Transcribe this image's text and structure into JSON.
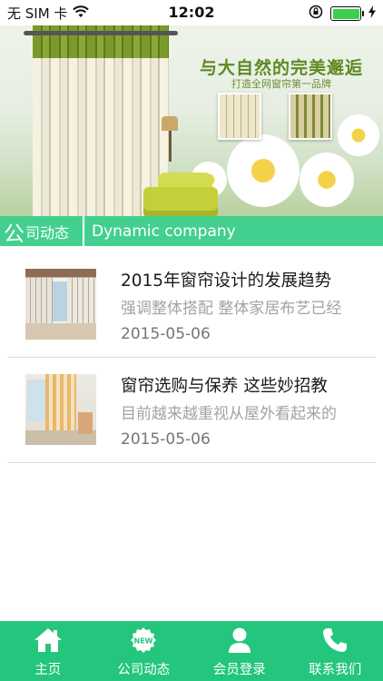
{
  "status_bar": {
    "carrier": "无 SIM 卡",
    "time": "12:02"
  },
  "banner": {
    "slogan": "与大自然的完美邂逅",
    "slogan_sub": "打造全网窗帘第一品牌",
    "active_slide": 2,
    "slide_count": 3
  },
  "section_header": {
    "title_first_char": "公",
    "title_rest": "司动态",
    "subtitle": "Dynamic company"
  },
  "news": [
    {
      "title": "2015年窗帘设计的发展趋势",
      "summary": "强调整体搭配 整体家居布艺已经",
      "date": "2015-05-06",
      "thumbnail": "curtain-room-photo"
    },
    {
      "title": "窗帘选购与保养 这些妙招教",
      "summary": "目前越来越重视从屋外看起来的",
      "date": "2015-05-06",
      "thumbnail": "curtain-living-room-photo"
    }
  ],
  "bottom_nav": [
    {
      "label": "主页",
      "icon": "home-icon"
    },
    {
      "label": "公司动态",
      "icon": "new-badge-icon"
    },
    {
      "label": "会员登录",
      "icon": "user-icon"
    },
    {
      "label": "联系我们",
      "icon": "phone-icon"
    }
  ],
  "colors": {
    "accent": "#24c57d",
    "section_header": "#43d08f",
    "active_dot": "#ec5a8e"
  }
}
